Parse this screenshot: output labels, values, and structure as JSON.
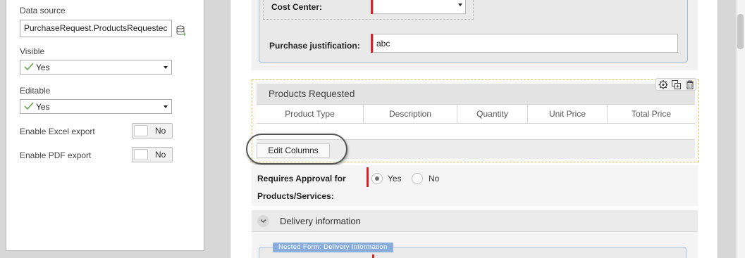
{
  "properties": {
    "data_source_label": "Data source",
    "data_source_value": "PurchaseRequest.ProductsRequestec",
    "visible_label": "Visible",
    "visible_value": "Yes",
    "editable_label": "Editable",
    "editable_value": "Yes",
    "excel_export_label": "Enable Excel export",
    "excel_export_value": "No",
    "pdf_export_label": "Enable PDF export",
    "pdf_export_value": "No"
  },
  "form": {
    "cost_center_label": "Cost Center:",
    "cost_center_value": "",
    "justification_label": "Purchase justification:",
    "justification_value": "abc"
  },
  "products_grid": {
    "title": "Products Requested",
    "columns": [
      "Product Type",
      "Description",
      "Quantity",
      "Unit Price",
      "Total Price"
    ],
    "edit_columns_label": "Edit Columns"
  },
  "approval": {
    "label_line1": "Requires Approval for",
    "label_line2": "Products/Services:",
    "options": [
      "Yes",
      "No"
    ],
    "selected": "Yes"
  },
  "delivery": {
    "title": "Delivery information",
    "nested_tag": "Nested Form: Delivery Information"
  },
  "colors": {
    "required_marker": "#d9232d",
    "highlight_dashed": "#e3c14e",
    "nested_tag_bg": "#89aede"
  }
}
